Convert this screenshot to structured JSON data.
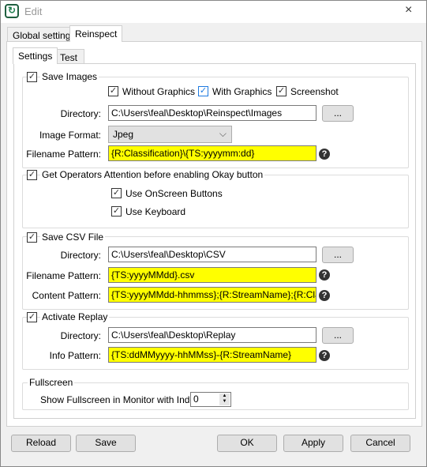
{
  "window": {
    "title": "Edit",
    "close_icon": "×"
  },
  "tabs": [
    {
      "label": "Global settings"
    },
    {
      "label": "Reinspect",
      "selected": true
    }
  ],
  "subtabs": [
    {
      "label": "Settings",
      "selected": true
    },
    {
      "label": "Test"
    }
  ],
  "save_images": {
    "label": "Save Images",
    "checked": true,
    "options": [
      {
        "label": "Without Graphics",
        "checked": true
      },
      {
        "label": "With Graphics",
        "checked": true
      },
      {
        "label": "Screenshot",
        "checked": true
      }
    ],
    "directory_label": "Directory:",
    "directory": "C:\\Users\\feal\\Desktop\\Reinspect\\Images",
    "browse": "...",
    "format_label": "Image Format:",
    "format": "Jpeg",
    "pattern_label": "Filename Pattern:",
    "pattern": "{R:Classification}\\{TS:yyyymm:dd}"
  },
  "attention": {
    "label": "Get Operators Attention before enabling Okay button",
    "checked": true,
    "options": [
      {
        "label": "Use OnScreen Buttons",
        "checked": true
      },
      {
        "label": "Use Keyboard",
        "checked": true
      }
    ]
  },
  "csv": {
    "label": "Save CSV File",
    "checked": true,
    "directory_label": "Directory:",
    "directory": "C:\\Users\\feal\\Desktop\\CSV",
    "browse": "...",
    "pattern_label": "Filename Pattern:",
    "pattern": "{TS:yyyyMMdd}.csv",
    "content_label": "Content Pattern:",
    "content": "{TS:yyyyMMdd-hhmmss};{R:StreamName};{R:Classification}"
  },
  "replay": {
    "label": "Activate Replay",
    "checked": true,
    "directory_label": "Directory:",
    "directory": "C:\\Users\\feal\\Desktop\\Replay",
    "browse": "...",
    "info_label": "Info Pattern:",
    "info": "{TS:ddMMyyyy-hhMMss}-{R:StreamName}"
  },
  "fullscreen": {
    "label": "Fullscreen",
    "index_label": "Show Fullscreen in Monitor with Index:",
    "index": "0"
  },
  "buttons": {
    "reload": "Reload",
    "save": "Save",
    "ok": "OK",
    "apply": "Apply",
    "cancel": "Cancel"
  },
  "highlight_color": "#ffff00"
}
